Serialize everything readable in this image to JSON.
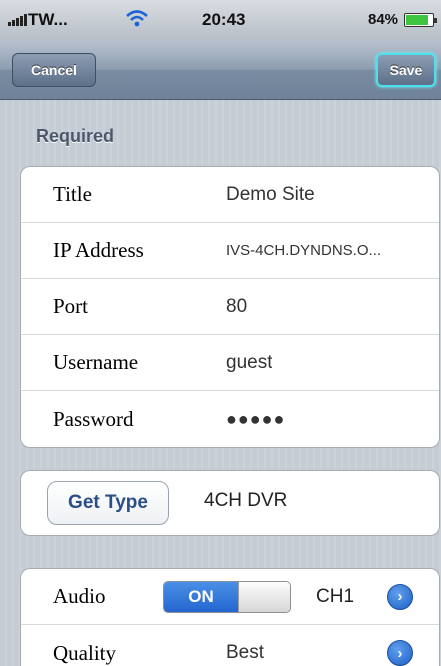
{
  "status_bar": {
    "carrier": "TW...",
    "time": "20:43",
    "battery": "84%",
    "battery_level": 0.84
  },
  "nav": {
    "cancel_label": "Cancel",
    "save_label": "Save"
  },
  "section": {
    "header": "Required"
  },
  "fields": [
    {
      "label": "Title",
      "value": "Demo Site"
    },
    {
      "label": "IP Address",
      "value": "IVS-4CH.DYNDNS.O..."
    },
    {
      "label": "Port",
      "value": "80"
    },
    {
      "label": "Username",
      "value": "guest"
    },
    {
      "label": "Password",
      "value": "●●●●●"
    }
  ],
  "type": {
    "button_label": "Get Type",
    "value": "4CH DVR"
  },
  "audio": {
    "label": "Audio",
    "toggle_label": "ON",
    "toggle_on": true,
    "channel": "CH1",
    "disclosure_icon": "chevron-right-icon"
  },
  "quality": {
    "label": "Quality",
    "value": "Best",
    "disclosure_icon": "chevron-right-icon"
  },
  "colors": {
    "accent": "#2466cf",
    "nav_bar": "#7a8ca2",
    "save_highlight": "#4fe0ee"
  }
}
